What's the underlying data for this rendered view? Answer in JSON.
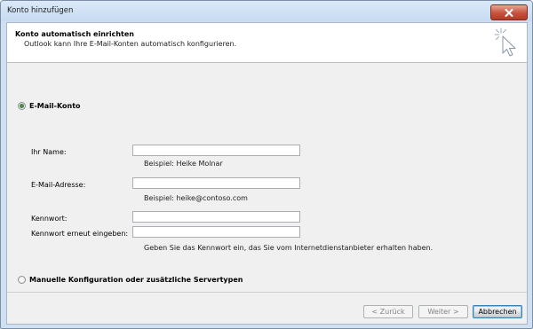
{
  "window": {
    "title": "Konto hinzufügen"
  },
  "header": {
    "title": "Konto automatisch einrichten",
    "subtitle": "Outlook kann Ihre E-Mail-Konten automatisch konfigurieren."
  },
  "options": {
    "email_account": {
      "label": "E-Mail-Konto",
      "selected": true
    },
    "manual": {
      "label": "Manuelle Konfiguration oder zusätzliche Servertypen",
      "selected": false
    }
  },
  "form": {
    "name": {
      "label": "Ihr Name:",
      "value": "",
      "hint": "Beispiel: Heike Molnar"
    },
    "email": {
      "label": "E-Mail-Adresse:",
      "value": "",
      "hint": "Beispiel: heike@contoso.com"
    },
    "password": {
      "label": "Kennwort:",
      "value": ""
    },
    "password_confirm": {
      "label": "Kennwort erneut eingeben:",
      "value": "",
      "hint": "Geben Sie das Kennwort ein, das Sie vom Internetdienstanbieter erhalten haben."
    }
  },
  "buttons": {
    "back": "< Zurück",
    "next": "Weiter >",
    "cancel": "Abbrechen"
  },
  "colors": {
    "title_bar": "#cfe0f3",
    "close_button": "#c6523c",
    "selected_radio": "#2e6a28",
    "default_button_border": "#3c7fb1"
  },
  "icons": {
    "close": "close-icon",
    "wizard": "wizard-cursor-icon"
  }
}
